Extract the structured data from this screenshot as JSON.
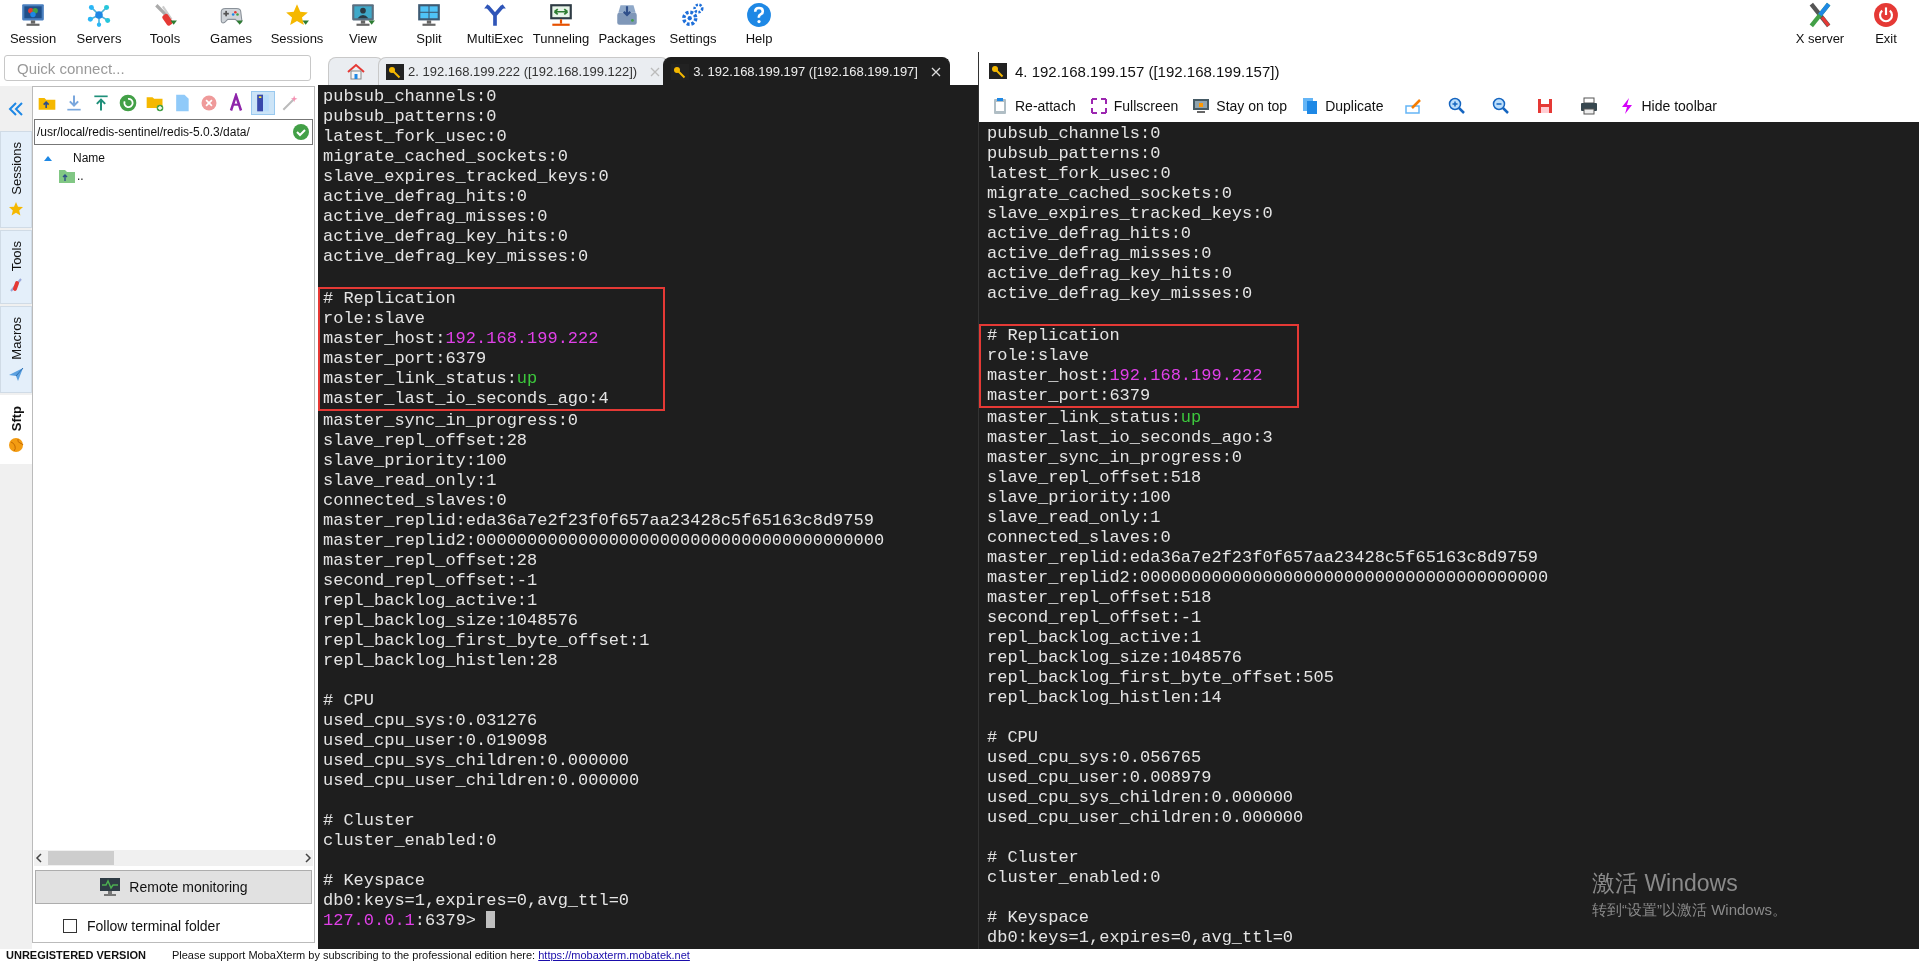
{
  "toolbar": {
    "items": [
      {
        "label": "Session"
      },
      {
        "label": "Servers"
      },
      {
        "label": "Tools"
      },
      {
        "label": "Games"
      },
      {
        "label": "Sessions"
      },
      {
        "label": "View"
      },
      {
        "label": "Split"
      },
      {
        "label": "MultiExec"
      },
      {
        "label": "Tunneling"
      },
      {
        "label": "Packages"
      },
      {
        "label": "Settings"
      },
      {
        "label": "Help"
      }
    ],
    "right_items": [
      {
        "label": "X server"
      },
      {
        "label": "Exit"
      }
    ]
  },
  "quick_connect": {
    "placeholder": "Quick connect..."
  },
  "side_tabs": [
    {
      "label": "Sessions",
      "selected": false
    },
    {
      "label": "Tools",
      "selected": false
    },
    {
      "label": "Macros",
      "selected": false
    },
    {
      "label": "Sftp",
      "selected": true
    }
  ],
  "sftp": {
    "toolbar_buttons": [
      {
        "pressed": false
      },
      {
        "pressed": false
      },
      {
        "pressed": false
      },
      {
        "pressed": false
      },
      {
        "pressed": false
      },
      {
        "pressed": false
      },
      {
        "pressed": false
      },
      {
        "pressed": false
      },
      {
        "pressed": true
      },
      {
        "pressed": false
      }
    ],
    "path": "/usr/local/redis-sentinel/redis-5.0.3/data/",
    "column": "Name",
    "rows": [
      {
        "name": ".."
      }
    ],
    "remote_monitoring": "Remote monitoring",
    "follow_terminal_folder": {
      "label": "Follow terminal folder",
      "checked": false
    }
  },
  "tabs": [
    {
      "kind": "home",
      "selected": false
    },
    {
      "kind": "session",
      "label": "2.  192.168.199.222  ([192.168.199.122])",
      "selected": false
    },
    {
      "kind": "session",
      "label": "3.  192.168.199.197  ([192.168.199.197]",
      "selected": true
    }
  ],
  "terminal_left": {
    "lines": [
      {
        "kind": "text",
        "highlighted": false,
        "parts": [
          {
            "text": "pubsub_channels:0"
          }
        ]
      },
      {
        "kind": "text",
        "highlighted": false,
        "parts": [
          {
            "text": "pubsub_patterns:0"
          }
        ]
      },
      {
        "kind": "text",
        "highlighted": false,
        "parts": [
          {
            "text": "latest_fork_usec:0"
          }
        ]
      },
      {
        "kind": "text",
        "highlighted": false,
        "parts": [
          {
            "text": "migrate_cached_sockets:0"
          }
        ]
      },
      {
        "kind": "text",
        "highlighted": false,
        "parts": [
          {
            "text": "slave_expires_tracked_keys:0"
          }
        ]
      },
      {
        "kind": "text",
        "highlighted": false,
        "parts": [
          {
            "text": "active_defrag_hits:0"
          }
        ]
      },
      {
        "kind": "text",
        "highlighted": false,
        "parts": [
          {
            "text": "active_defrag_misses:0"
          }
        ]
      },
      {
        "kind": "text",
        "highlighted": false,
        "parts": [
          {
            "text": "active_defrag_key_hits:0"
          }
        ]
      },
      {
        "kind": "text",
        "highlighted": false,
        "parts": [
          {
            "text": "active_defrag_key_misses:0"
          }
        ]
      },
      {
        "kind": "blank"
      },
      {
        "kind": "text",
        "highlighted": true,
        "parts": [
          {
            "text": "# Replication"
          }
        ]
      },
      {
        "kind": "text",
        "highlighted": true,
        "parts": [
          {
            "text": "role:slave"
          }
        ]
      },
      {
        "kind": "text",
        "highlighted": true,
        "parts": [
          {
            "text": "master_host:"
          },
          {
            "text": "192.168.199.222",
            "color": "#e040e8"
          }
        ]
      },
      {
        "kind": "text",
        "highlighted": true,
        "parts": [
          {
            "text": "master_port:6379"
          }
        ]
      },
      {
        "kind": "text",
        "highlighted": true,
        "parts": [
          {
            "text": "master_link_status:"
          },
          {
            "text": "up",
            "color": "#3cc83c"
          }
        ]
      },
      {
        "kind": "text",
        "highlighted": true,
        "parts": [
          {
            "text": "master_last_io_seconds_ago:4"
          }
        ]
      },
      {
        "kind": "text",
        "highlighted": false,
        "parts": [
          {
            "text": "master_sync_in_progress:0"
          }
        ]
      },
      {
        "kind": "text",
        "highlighted": false,
        "parts": [
          {
            "text": "slave_repl_offset:28"
          }
        ]
      },
      {
        "kind": "text",
        "highlighted": false,
        "parts": [
          {
            "text": "slave_priority:100"
          }
        ]
      },
      {
        "kind": "text",
        "highlighted": false,
        "parts": [
          {
            "text": "slave_read_only:1"
          }
        ]
      },
      {
        "kind": "text",
        "highlighted": false,
        "parts": [
          {
            "text": "connected_slaves:0"
          }
        ]
      },
      {
        "kind": "text",
        "highlighted": false,
        "parts": [
          {
            "text": "master_replid:eda36a7e2f23f0f657aa23428c5f65163c8d9759"
          }
        ]
      },
      {
        "kind": "text",
        "highlighted": false,
        "parts": [
          {
            "text": "master_replid2:0000000000000000000000000000000000000000"
          }
        ]
      },
      {
        "kind": "text",
        "highlighted": false,
        "parts": [
          {
            "text": "master_repl_offset:28"
          }
        ]
      },
      {
        "kind": "text",
        "highlighted": false,
        "parts": [
          {
            "text": "second_repl_offset:-1"
          }
        ]
      },
      {
        "kind": "text",
        "highlighted": false,
        "parts": [
          {
            "text": "repl_backlog_active:1"
          }
        ]
      },
      {
        "kind": "text",
        "highlighted": false,
        "parts": [
          {
            "text": "repl_backlog_size:1048576"
          }
        ]
      },
      {
        "kind": "text",
        "highlighted": false,
        "parts": [
          {
            "text": "repl_backlog_first_byte_offset:1"
          }
        ]
      },
      {
        "kind": "text",
        "highlighted": false,
        "parts": [
          {
            "text": "repl_backlog_histlen:28"
          }
        ]
      },
      {
        "kind": "blank"
      },
      {
        "kind": "text",
        "highlighted": false,
        "parts": [
          {
            "text": "# CPU"
          }
        ]
      },
      {
        "kind": "text",
        "highlighted": false,
        "parts": [
          {
            "text": "used_cpu_sys:0.031276"
          }
        ]
      },
      {
        "kind": "text",
        "highlighted": false,
        "parts": [
          {
            "text": "used_cpu_user:0.019098"
          }
        ]
      },
      {
        "kind": "text",
        "highlighted": false,
        "parts": [
          {
            "text": "used_cpu_sys_children:0.000000"
          }
        ]
      },
      {
        "kind": "text",
        "highlighted": false,
        "parts": [
          {
            "text": "used_cpu_user_children:0.000000"
          }
        ]
      },
      {
        "kind": "blank"
      },
      {
        "kind": "text",
        "highlighted": false,
        "parts": [
          {
            "text": "# Cluster"
          }
        ]
      },
      {
        "kind": "text",
        "highlighted": false,
        "parts": [
          {
            "text": "cluster_enabled:0"
          }
        ]
      },
      {
        "kind": "blank"
      },
      {
        "kind": "text",
        "highlighted": false,
        "parts": [
          {
            "text": "# Keyspace"
          }
        ]
      },
      {
        "kind": "text",
        "highlighted": false,
        "parts": [
          {
            "text": "db0:keys=1,expires=0,avg_ttl=0"
          }
        ]
      },
      {
        "kind": "prompt",
        "highlighted": false,
        "cursor": true,
        "parts": [
          {
            "text": "127.0.0.1",
            "color": "#e040e8"
          },
          {
            "text": ":6379>"
          }
        ]
      }
    ]
  },
  "window": {
    "title": "4. 192.168.199.157 ([192.168.199.157])",
    "toolbar": [
      {
        "kind": "labeled",
        "label": "Re-attach"
      },
      {
        "kind": "labeled",
        "label": "Fullscreen"
      },
      {
        "kind": "labeled",
        "label": "Stay on top"
      },
      {
        "kind": "labeled",
        "label": "Duplicate"
      },
      {
        "kind": "icon"
      },
      {
        "kind": "icon"
      },
      {
        "kind": "icon"
      },
      {
        "kind": "icon"
      },
      {
        "kind": "icon"
      },
      {
        "kind": "labeled",
        "label": "Hide toolbar"
      }
    ],
    "lines": [
      {
        "kind": "text",
        "highlighted": false,
        "parts": [
          {
            "text": "pubsub_channels:0"
          }
        ]
      },
      {
        "kind": "text",
        "highlighted": false,
        "parts": [
          {
            "text": "pubsub_patterns:0"
          }
        ]
      },
      {
        "kind": "text",
        "highlighted": false,
        "parts": [
          {
            "text": "latest_fork_usec:0"
          }
        ]
      },
      {
        "kind": "text",
        "highlighted": false,
        "parts": [
          {
            "text": "migrate_cached_sockets:0"
          }
        ]
      },
      {
        "kind": "text",
        "highlighted": false,
        "parts": [
          {
            "text": "slave_expires_tracked_keys:0"
          }
        ]
      },
      {
        "kind": "text",
        "highlighted": false,
        "parts": [
          {
            "text": "active_defrag_hits:0"
          }
        ]
      },
      {
        "kind": "text",
        "highlighted": false,
        "parts": [
          {
            "text": "active_defrag_misses:0"
          }
        ]
      },
      {
        "kind": "text",
        "highlighted": false,
        "parts": [
          {
            "text": "active_defrag_key_hits:0"
          }
        ]
      },
      {
        "kind": "text",
        "highlighted": false,
        "parts": [
          {
            "text": "active_defrag_key_misses:0"
          }
        ]
      },
      {
        "kind": "blank"
      },
      {
        "kind": "text",
        "highlighted": true,
        "parts": [
          {
            "text": "# Replication"
          }
        ]
      },
      {
        "kind": "text",
        "highlighted": true,
        "parts": [
          {
            "text": "role:slave"
          }
        ]
      },
      {
        "kind": "text",
        "highlighted": true,
        "parts": [
          {
            "text": "master_host:"
          },
          {
            "text": "192.168.199.222",
            "color": "#e040e8"
          }
        ]
      },
      {
        "kind": "text",
        "highlighted": true,
        "parts": [
          {
            "text": "master_port:6379"
          }
        ]
      },
      {
        "kind": "text",
        "highlighted": false,
        "parts": [
          {
            "text": "master_link_status:"
          },
          {
            "text": "up",
            "color": "#3cc83c"
          }
        ]
      },
      {
        "kind": "text",
        "highlighted": false,
        "parts": [
          {
            "text": "master_last_io_seconds_ago:3"
          }
        ]
      },
      {
        "kind": "text",
        "highlighted": false,
        "parts": [
          {
            "text": "master_sync_in_progress:0"
          }
        ]
      },
      {
        "kind": "text",
        "highlighted": false,
        "parts": [
          {
            "text": "slave_repl_offset:518"
          }
        ]
      },
      {
        "kind": "text",
        "highlighted": false,
        "parts": [
          {
            "text": "slave_priority:100"
          }
        ]
      },
      {
        "kind": "text",
        "highlighted": false,
        "parts": [
          {
            "text": "slave_read_only:1"
          }
        ]
      },
      {
        "kind": "text",
        "highlighted": false,
        "parts": [
          {
            "text": "connected_slaves:0"
          }
        ]
      },
      {
        "kind": "text",
        "highlighted": false,
        "parts": [
          {
            "text": "master_replid:eda36a7e2f23f0f657aa23428c5f65163c8d9759"
          }
        ]
      },
      {
        "kind": "text",
        "highlighted": false,
        "parts": [
          {
            "text": "master_replid2:0000000000000000000000000000000000000000"
          }
        ]
      },
      {
        "kind": "text",
        "highlighted": false,
        "parts": [
          {
            "text": "master_repl_offset:518"
          }
        ]
      },
      {
        "kind": "text",
        "highlighted": false,
        "parts": [
          {
            "text": "second_repl_offset:-1"
          }
        ]
      },
      {
        "kind": "text",
        "highlighted": false,
        "parts": [
          {
            "text": "repl_backlog_active:1"
          }
        ]
      },
      {
        "kind": "text",
        "highlighted": false,
        "parts": [
          {
            "text": "repl_backlog_size:1048576"
          }
        ]
      },
      {
        "kind": "text",
        "highlighted": false,
        "parts": [
          {
            "text": "repl_backlog_first_byte_offset:505"
          }
        ]
      },
      {
        "kind": "text",
        "highlighted": false,
        "parts": [
          {
            "text": "repl_backlog_histlen:14"
          }
        ]
      },
      {
        "kind": "blank"
      },
      {
        "kind": "text",
        "highlighted": false,
        "parts": [
          {
            "text": "# CPU"
          }
        ]
      },
      {
        "kind": "text",
        "highlighted": false,
        "parts": [
          {
            "text": "used_cpu_sys:0.056765"
          }
        ]
      },
      {
        "kind": "text",
        "highlighted": false,
        "parts": [
          {
            "text": "used_cpu_user:0.008979"
          }
        ]
      },
      {
        "kind": "text",
        "highlighted": false,
        "parts": [
          {
            "text": "used_cpu_sys_children:0.000000"
          }
        ]
      },
      {
        "kind": "text",
        "highlighted": false,
        "parts": [
          {
            "text": "used_cpu_user_children:0.000000"
          }
        ]
      },
      {
        "kind": "blank"
      },
      {
        "kind": "text",
        "highlighted": false,
        "parts": [
          {
            "text": "# Cluster"
          }
        ]
      },
      {
        "kind": "text",
        "highlighted": false,
        "parts": [
          {
            "text": "cluster_enabled:0"
          }
        ]
      },
      {
        "kind": "blank"
      },
      {
        "kind": "text",
        "highlighted": false,
        "parts": [
          {
            "text": "# Keyspace"
          }
        ]
      },
      {
        "kind": "text",
        "highlighted": false,
        "parts": [
          {
            "text": "db0:keys=1,expires=0,avg_ttl=0"
          }
        ]
      }
    ]
  },
  "activation_notice": {
    "title": "激活 Windows",
    "message": "转到“设置”以激活 Windows。"
  },
  "status_bar": {
    "label": "UNREGISTERED VERSION",
    "message": "Please support MobaXterm by subscribing to the professional edition here:",
    "link": "https://mobaxterm.mobatek.net"
  }
}
